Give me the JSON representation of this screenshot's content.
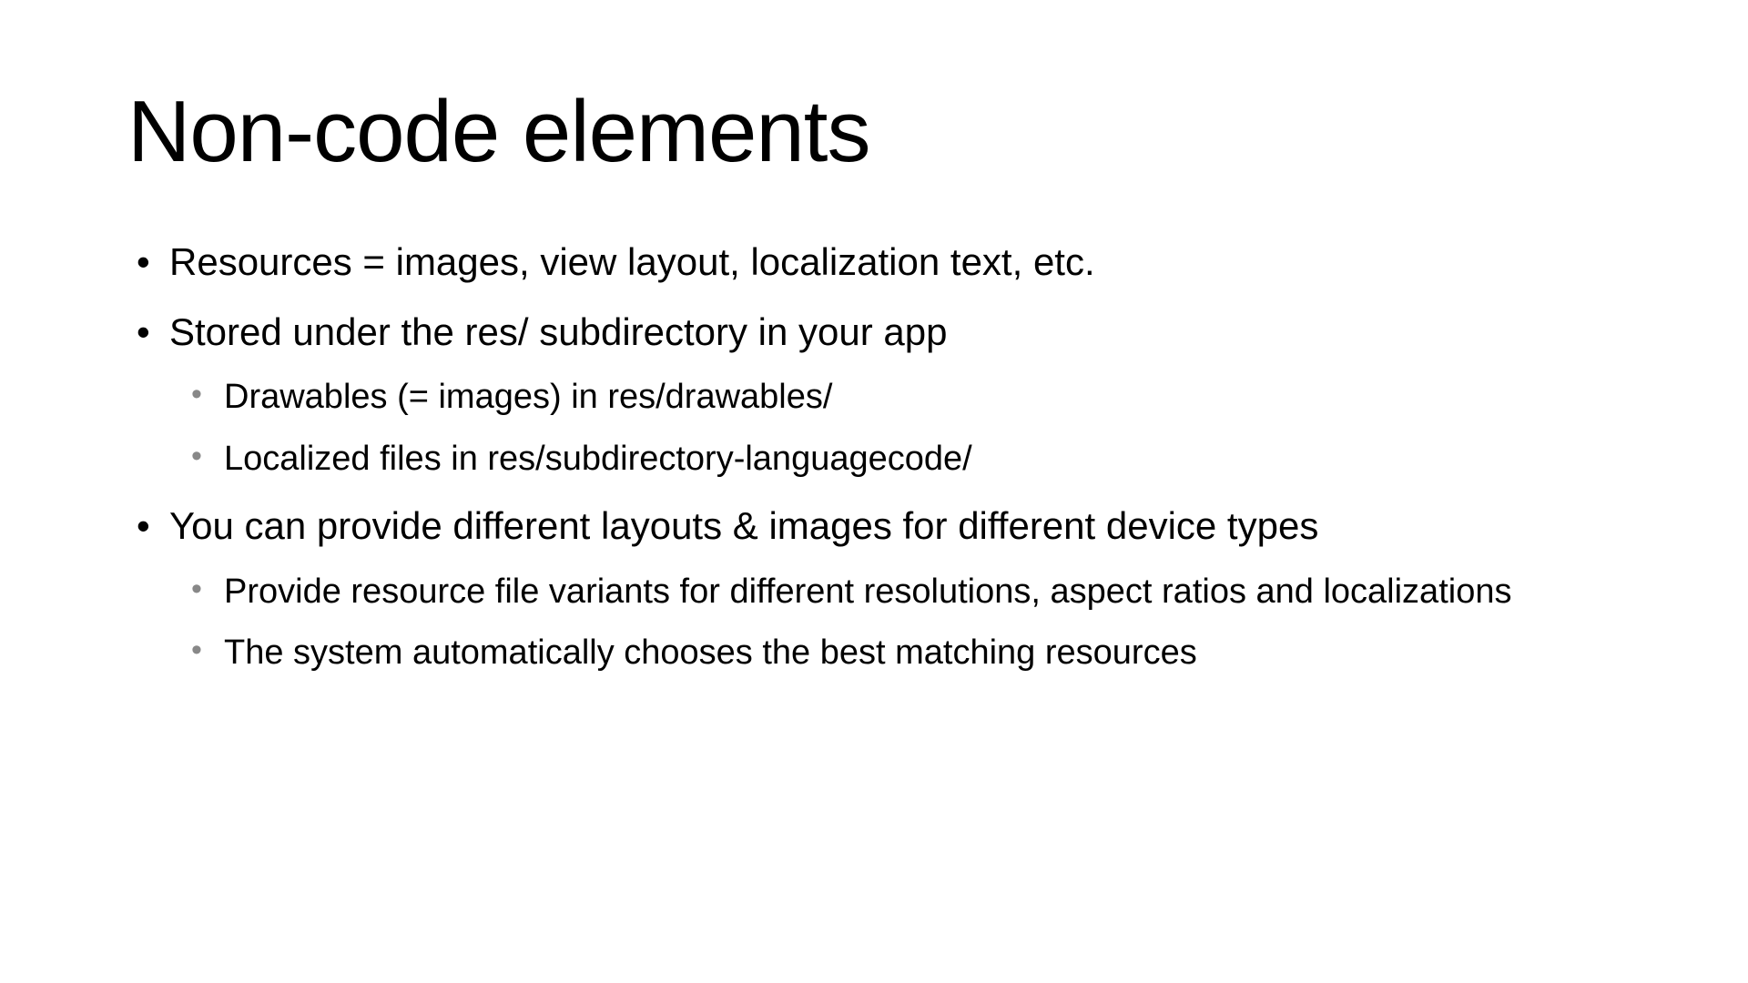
{
  "title": "Non-code elements",
  "bullets": {
    "b0": "Resources = images, view layout, localization text, etc.",
    "b1": "Stored under the res/ subdirectory in your app",
    "b1_sub0": "Drawables (= images) in res/drawables/",
    "b1_sub1": "Localized files in res/subdirectory-languagecode/",
    "b2": "You can provide different layouts & images for different device types",
    "b2_sub0": "Provide resource file variants for different resolutions, aspect ratios and localizations",
    "b2_sub1": "The system automatically chooses the best matching resources"
  }
}
